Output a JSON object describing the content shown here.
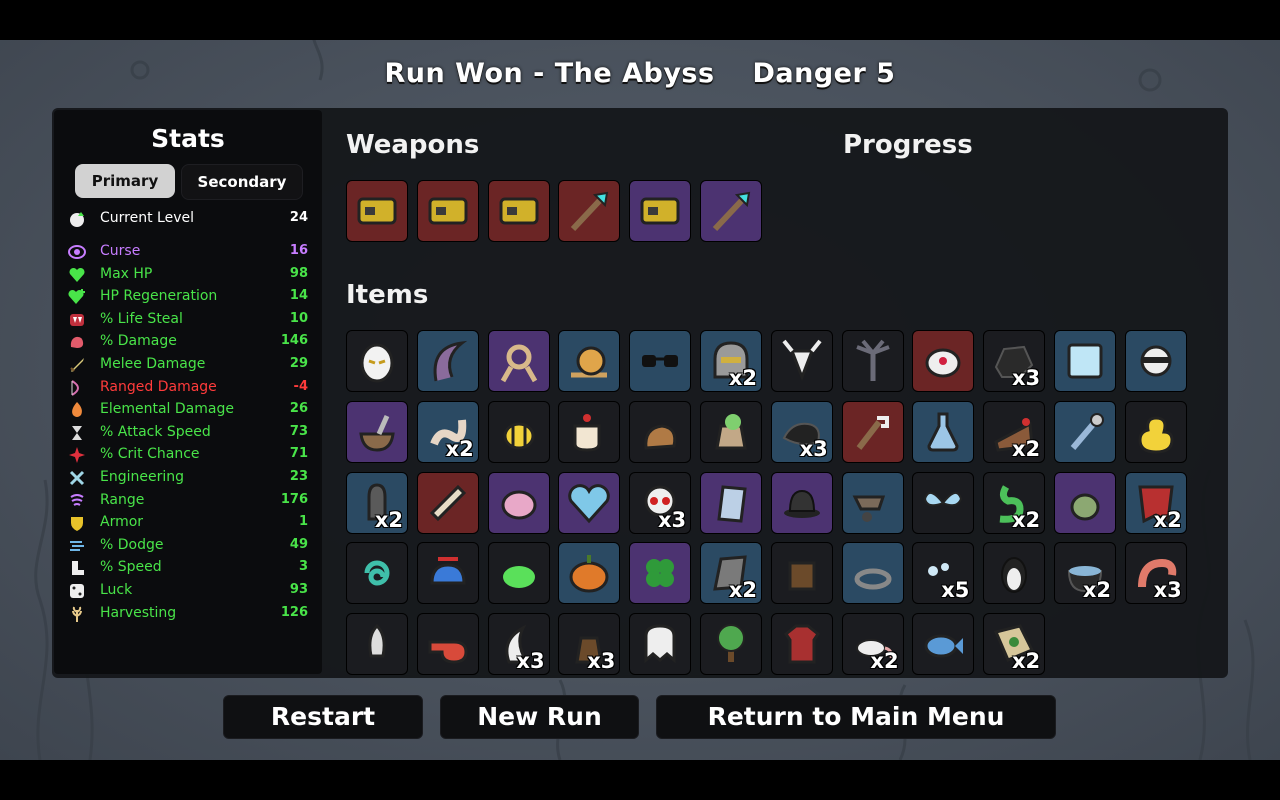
{
  "header": {
    "run_result": "Run Won - The Abyss",
    "danger": "Danger 5"
  },
  "stats": {
    "title": "Stats",
    "tabs": {
      "primary": "Primary",
      "secondary": "Secondary"
    },
    "rows": [
      {
        "label": "Current Level",
        "value": "24",
        "color": "#ffffff",
        "icon": "level-up-icon"
      },
      {
        "label": "Curse",
        "value": "16",
        "color": "#c77dff",
        "icon": "curse-eye-icon"
      },
      {
        "label": "Max HP",
        "value": "98",
        "color": "#49e449",
        "icon": "heart-icon"
      },
      {
        "label": "HP Regeneration",
        "value": "14",
        "color": "#49e449",
        "icon": "heart-plus-icon"
      },
      {
        "label": "% Life Steal",
        "value": "10",
        "color": "#49e449",
        "icon": "fangs-icon"
      },
      {
        "label": "% Damage",
        "value": "146",
        "color": "#49e449",
        "icon": "muscle-icon"
      },
      {
        "label": "Melee Damage",
        "value": "29",
        "color": "#49e449",
        "icon": "sword-icon"
      },
      {
        "label": "Ranged Damage",
        "value": "-4",
        "color": "#ff3b3b",
        "icon": "bow-icon"
      },
      {
        "label": "Elemental Damage",
        "value": "26",
        "color": "#49e449",
        "icon": "flame-icon"
      },
      {
        "label": "% Attack Speed",
        "value": "73",
        "color": "#49e449",
        "icon": "hourglass-icon"
      },
      {
        "label": "% Crit Chance",
        "value": "71",
        "color": "#49e449",
        "icon": "crit-burst-icon"
      },
      {
        "label": "Engineering",
        "value": "23",
        "color": "#49e449",
        "icon": "wrench-cross-icon"
      },
      {
        "label": "Range",
        "value": "176",
        "color": "#49e449",
        "icon": "range-waves-icon"
      },
      {
        "label": "Armor",
        "value": "1",
        "color": "#49e449",
        "icon": "shield-icon"
      },
      {
        "label": "% Dodge",
        "value": "49",
        "color": "#49e449",
        "icon": "dodge-wind-icon"
      },
      {
        "label": "% Speed",
        "value": "3",
        "color": "#49e449",
        "icon": "boot-icon"
      },
      {
        "label": "Luck",
        "value": "93",
        "color": "#49e449",
        "icon": "dice-icon"
      },
      {
        "label": "Harvesting",
        "value": "126",
        "color": "#49e449",
        "icon": "wheat-icon"
      }
    ]
  },
  "weapons": {
    "title": "Weapons",
    "slots": [
      {
        "tier": 4,
        "icon": "gold-gauntlet-icon"
      },
      {
        "tier": 4,
        "icon": "gold-gauntlet-icon"
      },
      {
        "tier": 4,
        "icon": "gold-gauntlet-icon"
      },
      {
        "tier": 4,
        "icon": "crystal-spear-icon"
      },
      {
        "tier": 3,
        "icon": "gold-gauntlet-icon"
      },
      {
        "tier": 3,
        "icon": "crystal-spear-icon"
      }
    ]
  },
  "progress": {
    "title": "Progress"
  },
  "items": {
    "title": "Items",
    "slots": [
      {
        "tier": 1,
        "icon": "angry-egg-icon",
        "count": ""
      },
      {
        "tier": 2,
        "icon": "tentacle-icon",
        "count": ""
      },
      {
        "tier": 3,
        "icon": "rope-knot-icon",
        "count": ""
      },
      {
        "tier": 2,
        "icon": "snail-icon",
        "count": ""
      },
      {
        "tier": 2,
        "icon": "sunglasses-icon",
        "count": ""
      },
      {
        "tier": 2,
        "icon": "knight-helmet-icon",
        "count": "x2"
      },
      {
        "tier": 1,
        "icon": "goat-skull-icon",
        "count": ""
      },
      {
        "tier": 1,
        "icon": "dead-palm-icon",
        "count": ""
      },
      {
        "tier": 4,
        "icon": "cyber-eye-icon",
        "count": ""
      },
      {
        "tier": 1,
        "icon": "coal-rock-icon",
        "count": "x3"
      },
      {
        "tier": 2,
        "icon": "ice-cube-icon",
        "count": ""
      },
      {
        "tier": 2,
        "icon": "ninja-ball-icon",
        "count": ""
      },
      {
        "tier": 3,
        "icon": "mortar-pestle-icon",
        "count": ""
      },
      {
        "tier": 2,
        "icon": "worm-icon",
        "count": "x2"
      },
      {
        "tier": 1,
        "icon": "bee-icon",
        "count": ""
      },
      {
        "tier": 1,
        "icon": "coffee-cup-icon",
        "count": ""
      },
      {
        "tier": 1,
        "icon": "squirrel-icon",
        "count": ""
      },
      {
        "tier": 1,
        "icon": "moss-sack-icon",
        "count": ""
      },
      {
        "tier": 2,
        "icon": "black-cloth-icon",
        "count": "x3"
      },
      {
        "tier": 4,
        "icon": "robot-arm-icon",
        "count": ""
      },
      {
        "tier": 2,
        "icon": "potion-flask-icon",
        "count": ""
      },
      {
        "tier": 1,
        "icon": "cake-slice-icon",
        "count": "x2"
      },
      {
        "tier": 2,
        "icon": "glass-pipe-icon",
        "count": ""
      },
      {
        "tier": 1,
        "icon": "rubber-duck-icon",
        "count": ""
      },
      {
        "tier": 2,
        "icon": "bullet-icon",
        "count": "x2"
      },
      {
        "tier": 4,
        "icon": "scroll-icon",
        "count": ""
      },
      {
        "tier": 3,
        "icon": "pink-brain-icon",
        "count": ""
      },
      {
        "tier": 3,
        "icon": "frozen-heart-icon",
        "count": ""
      },
      {
        "tier": 1,
        "icon": "skull-icon",
        "count": "x3"
      },
      {
        "tier": 3,
        "icon": "mirror-icon",
        "count": ""
      },
      {
        "tier": 3,
        "icon": "bowler-hat-icon",
        "count": ""
      },
      {
        "tier": 2,
        "icon": "wheelbarrow-icon",
        "count": ""
      },
      {
        "tier": 1,
        "icon": "butterfly-icon",
        "count": ""
      },
      {
        "tier": 1,
        "icon": "green-snake-icon",
        "count": "x2"
      },
      {
        "tier": 3,
        "icon": "fly-creature-icon",
        "count": ""
      },
      {
        "tier": 2,
        "icon": "red-cape-icon",
        "count": "x2"
      },
      {
        "tier": 1,
        "icon": "teal-spiral-icon",
        "count": ""
      },
      {
        "tier": 1,
        "icon": "propeller-hat-icon",
        "count": ""
      },
      {
        "tier": 1,
        "icon": "green-slime-icon",
        "count": ""
      },
      {
        "tier": 2,
        "icon": "pumpkin-icon",
        "count": ""
      },
      {
        "tier": 3,
        "icon": "clover-icon",
        "count": ""
      },
      {
        "tier": 2,
        "icon": "stone-slab-icon",
        "count": "x2"
      },
      {
        "tier": 1,
        "icon": "tree-stump-icon",
        "count": ""
      },
      {
        "tier": 2,
        "icon": "bone-ring-icon",
        "count": ""
      },
      {
        "tier": 1,
        "icon": "snow-pellets-icon",
        "count": "x5"
      },
      {
        "tier": 1,
        "icon": "penguin-icon",
        "count": ""
      },
      {
        "tier": 1,
        "icon": "cauldron-icon",
        "count": "x2"
      },
      {
        "tier": 1,
        "icon": "shrimp-icon",
        "count": "x3"
      },
      {
        "tier": 1,
        "icon": "rocket-icon",
        "count": ""
      },
      {
        "tier": 1,
        "icon": "whistle-icon",
        "count": ""
      },
      {
        "tier": 1,
        "icon": "white-claw-icon",
        "count": "x3"
      },
      {
        "tier": 1,
        "icon": "brown-sack-icon",
        "count": "x3"
      },
      {
        "tier": 1,
        "icon": "ghost-tooth-icon",
        "count": ""
      },
      {
        "tier": 1,
        "icon": "tree-icon",
        "count": ""
      },
      {
        "tier": 1,
        "icon": "plaid-shirt-icon",
        "count": ""
      },
      {
        "tier": 1,
        "icon": "white-rat-icon",
        "count": "x2"
      },
      {
        "tier": 1,
        "icon": "blue-fish-icon",
        "count": ""
      },
      {
        "tier": 1,
        "icon": "treasure-map-icon",
        "count": "x2"
      }
    ]
  },
  "buttons": {
    "restart": "Restart",
    "new_run": "New Run",
    "main_menu": "Return to Main Menu"
  }
}
